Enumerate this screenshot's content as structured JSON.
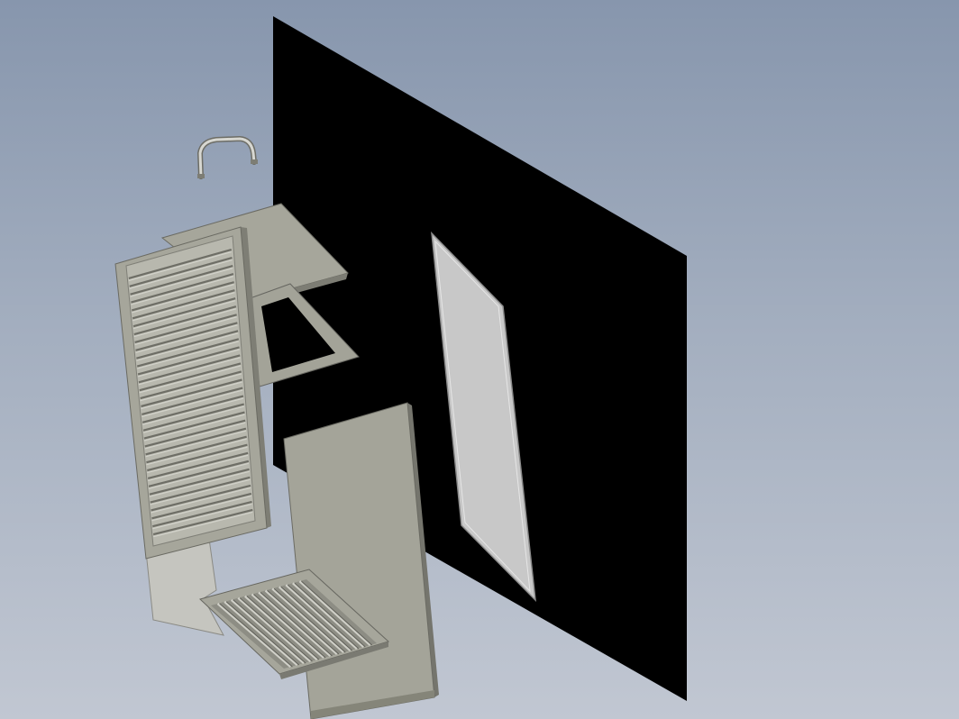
{
  "scene": {
    "kind": "cad-exploded-assembly-view",
    "background": {
      "top": "#8796ad",
      "bottom": "#c1c7d2"
    },
    "colors": {
      "panel": "#000000",
      "metal_front": "#a3a398",
      "metal_light": "#c2c2bc",
      "metal_dark": "#7d7d74",
      "edge": "#5f5f58",
      "gasket": "#c4c4c4"
    },
    "parts": [
      {
        "id": "mounting-panel",
        "color": "panel"
      },
      {
        "id": "handle"
      },
      {
        "id": "top-plate"
      },
      {
        "id": "rectangular-frame"
      },
      {
        "id": "louvered-door"
      },
      {
        "id": "side-plate"
      },
      {
        "id": "bottom-louver-grille"
      },
      {
        "id": "flat-cover-plate"
      },
      {
        "id": "gasket-sheet"
      }
    ]
  }
}
